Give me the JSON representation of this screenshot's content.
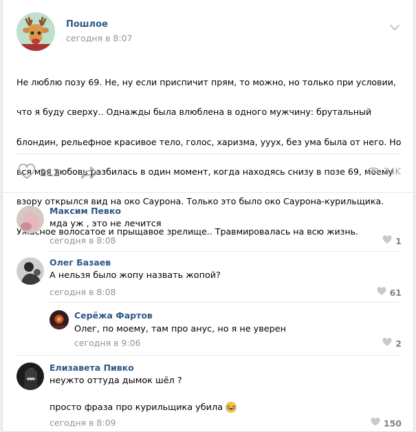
{
  "post": {
    "group_name": "Пошлое",
    "date": "сегодня в 8:07",
    "lines": [
      "Не люблю позу 69. Не, ну если приспичит прям, то можно, но только при условии,",
      "что я буду сверху.. Однажды была влюблена в одного мужчину: брутальный",
      "блондин, рельефное красивое тело, голос, харизма, уууx, без ума была от него. Но",
      "вся моя любовь разбилась в один момент, когда находясь снизу в позе 69, моему",
      "взору открылся вид на око Саурона. Только это было око Саурона-курильщика.",
      "Ужасное волосатое и прыщавое зрелище.. Травмировалась на всю жизнь."
    ],
    "likes": "212",
    "views": "34K"
  },
  "comments": [
    {
      "author": "Максим Певко",
      "text": "мда уж , это не лечится",
      "date": "сегодня в 8:08",
      "likes": "1"
    },
    {
      "author": "Олег Базаев",
      "text": "А нельзя было жопу назвать жопой?",
      "date": "сегодня в 8:08",
      "likes": "61"
    },
    {
      "author": "Серёжа Фартов",
      "text": "Олег, по моему, там про анус, но я не уверен",
      "date": "сегодня в 9:06",
      "likes": "2"
    },
    {
      "author": "Елизавета Пивко",
      "text": "неужто оттуда дымок шёл ?",
      "text2": "просто фраза про курильщика убила",
      "date": "сегодня в 8:09",
      "likes": "150"
    }
  ],
  "icons": {
    "menu": "chevron-down-icon",
    "like": "heart-icon",
    "share": "share-arrow-icon",
    "views": "eye-icon",
    "emoji": "laughing-emoji-icon"
  },
  "colors": {
    "link": "#2a5885",
    "meta": "#939393",
    "icon": "#828282"
  }
}
